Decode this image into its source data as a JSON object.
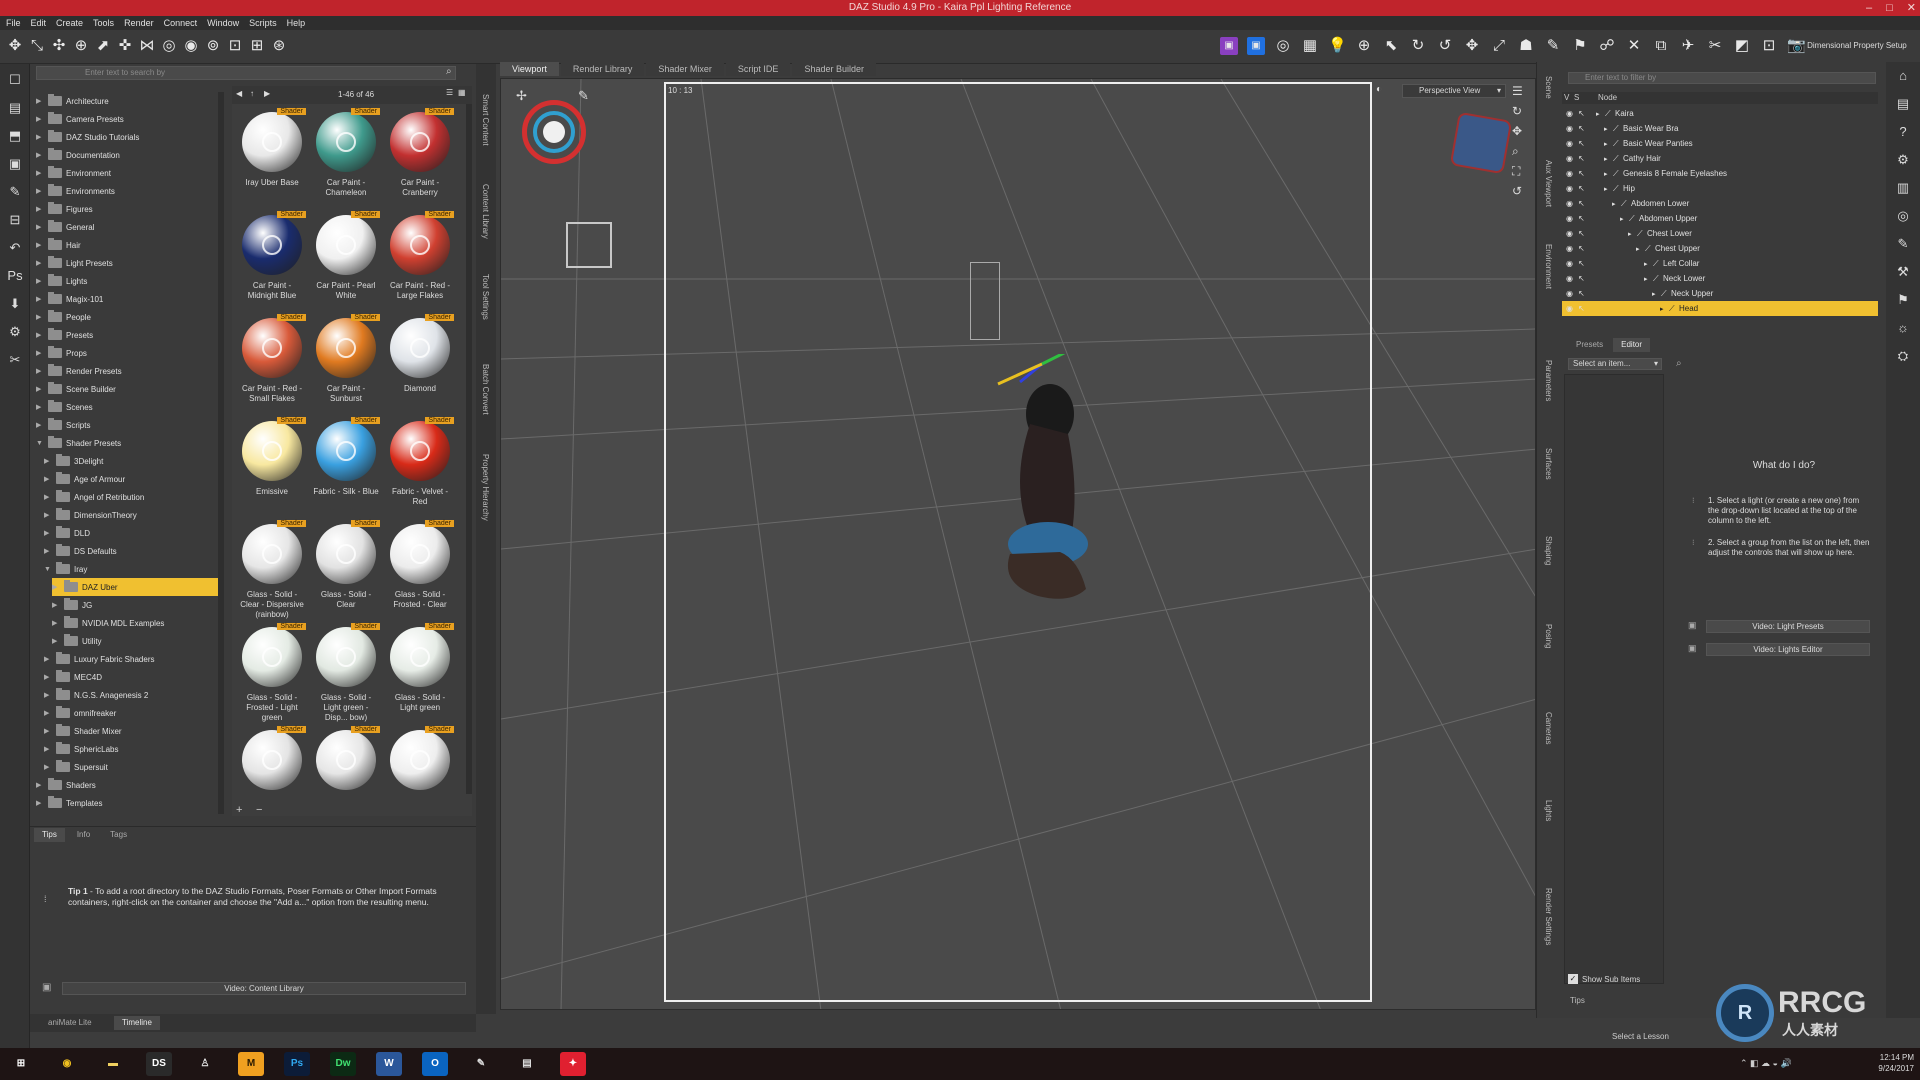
{
  "app": {
    "title": "DAZ Studio 4.9 Pro - Kaira Ppl Lighting Reference"
  },
  "menu": [
    "File",
    "Edit",
    "Create",
    "Tools",
    "Render",
    "Connect",
    "Window",
    "Scripts",
    "Help"
  ],
  "toolbar_right_label": "Multi Dimensional Property Setup",
  "content": {
    "search_placeholder": "Enter text to search by",
    "page_info": "1-46 of 46",
    "tree": [
      {
        "label": "Architecture",
        "depth": 1
      },
      {
        "label": "Camera Presets",
        "depth": 1
      },
      {
        "label": "DAZ Studio Tutorials",
        "depth": 1
      },
      {
        "label": "Documentation",
        "depth": 1
      },
      {
        "label": "Environment",
        "depth": 1
      },
      {
        "label": "Environments",
        "depth": 1
      },
      {
        "label": "Figures",
        "depth": 1
      },
      {
        "label": "General",
        "depth": 1
      },
      {
        "label": "Hair",
        "depth": 1
      },
      {
        "label": "Light Presets",
        "depth": 1
      },
      {
        "label": "Lights",
        "depth": 1
      },
      {
        "label": "Magix-101",
        "depth": 1
      },
      {
        "label": "People",
        "depth": 1
      },
      {
        "label": "Presets",
        "depth": 1
      },
      {
        "label": "Props",
        "depth": 1
      },
      {
        "label": "Render Presets",
        "depth": 1
      },
      {
        "label": "Scene Builder",
        "depth": 1
      },
      {
        "label": "Scenes",
        "depth": 1
      },
      {
        "label": "Scripts",
        "depth": 1
      },
      {
        "label": "Shader Presets",
        "depth": 1
      },
      {
        "label": "3Delight",
        "depth": 2
      },
      {
        "label": "Age of Armour",
        "depth": 2
      },
      {
        "label": "Angel of Retribution",
        "depth": 2
      },
      {
        "label": "DimensionTheory",
        "depth": 2
      },
      {
        "label": "DLD",
        "depth": 2
      },
      {
        "label": "DS Defaults",
        "depth": 2
      },
      {
        "label": "Iray",
        "depth": 2
      },
      {
        "label": "DAZ Uber",
        "depth": 3,
        "selected": true
      },
      {
        "label": "JG",
        "depth": 3
      },
      {
        "label": "NVIDIA MDL Examples",
        "depth": 3
      },
      {
        "label": "Utility",
        "depth": 3
      },
      {
        "label": "Luxury Fabric Shaders",
        "depth": 2
      },
      {
        "label": "MEC4D",
        "depth": 2
      },
      {
        "label": "N.G.S. Anagenesis 2",
        "depth": 2
      },
      {
        "label": "omnifreaker",
        "depth": 2
      },
      {
        "label": "Shader Mixer",
        "depth": 2
      },
      {
        "label": "SphericLabs",
        "depth": 2
      },
      {
        "label": "Supersuit",
        "depth": 2
      },
      {
        "label": "Shaders",
        "depth": 1
      },
      {
        "label": "Templates",
        "depth": 1
      }
    ],
    "badge": "Shader",
    "tiles": [
      {
        "label": "Iray Uber Base",
        "color": "#e8e8e8"
      },
      {
        "label": "Car Paint - Chameleon",
        "color": "#3f9a8c"
      },
      {
        "label": "Car Paint - Cranberry",
        "color": "#c23030"
      },
      {
        "label": "Car Paint - Midnight Blue",
        "color": "#1a2c6e"
      },
      {
        "label": "Car Paint - Pearl White",
        "color": "#f0f0f0"
      },
      {
        "label": "Car Paint - Red - Large Flakes",
        "color": "#d04030"
      },
      {
        "label": "Car Paint - Red - Small Flakes",
        "color": "#d85a3a"
      },
      {
        "label": "Car Paint - Sunburst",
        "color": "#e07a20"
      },
      {
        "label": "Diamond",
        "color": "#dfe3e8"
      },
      {
        "label": "Emissive",
        "color": "#f8e8a0"
      },
      {
        "label": "Fabric - Silk - Blue",
        "color": "#3aa0e0"
      },
      {
        "label": "Fabric - Velvet - Red",
        "color": "#d82a18"
      },
      {
        "label": "Glass - Solid - Clear - Dispersive (rainbow)",
        "color": "#e6e6e6"
      },
      {
        "label": "Glass - Solid - Clear",
        "color": "#e2e2e2"
      },
      {
        "label": "Glass - Solid - Frosted - Clear",
        "color": "#ececec"
      },
      {
        "label": "Glass - Solid - Frosted - Light green",
        "color": "#e4ebe4"
      },
      {
        "label": "Glass - Solid - Light green - Disp... bow)",
        "color": "#e2e9e2"
      },
      {
        "label": "Glass - Solid - Light green",
        "color": "#e6ece6"
      },
      {
        "label": "",
        "color": "#e4e4e4"
      },
      {
        "label": "",
        "color": "#e6e6e6"
      },
      {
        "label": "",
        "color": "#eeeeee"
      }
    ],
    "tips_tabs": [
      "Tips",
      "Info",
      "Tags"
    ],
    "tip_prefix": "Tip 1",
    "tip_text": " - To add a root directory to the DAZ Studio Formats, Poser Formats or Other Import Formats containers, right-click on the container and choose the \"Add a...\" option from the resulting menu.",
    "video_link": "Video: Content Library",
    "bottom_tabs": [
      "aniMate Lite",
      "Timeline"
    ],
    "side_tabs": [
      "Smart Content",
      "Content Library",
      "Tool Settings",
      "Batch Convert",
      "Property Hierarchy"
    ]
  },
  "viewport": {
    "tabs": [
      "Viewport",
      "Render Library",
      "Shader Mixer",
      "Script IDE",
      "Shader Builder"
    ],
    "aspect": "10 : 13",
    "view_label": "Perspective View"
  },
  "scene": {
    "filter_placeholder": "Enter text to filter by",
    "column": "Node",
    "nodes": [
      {
        "label": "Kaira",
        "depth": 0
      },
      {
        "label": "Basic Wear Bra",
        "depth": 1
      },
      {
        "label": "Basic Wear Panties",
        "depth": 1
      },
      {
        "label": "Cathy Hair",
        "depth": 1
      },
      {
        "label": "Genesis 8 Female Eyelashes",
        "depth": 1
      },
      {
        "label": "Hip",
        "depth": 1
      },
      {
        "label": "Abdomen Lower",
        "depth": 2
      },
      {
        "label": "Abdomen Upper",
        "depth": 3
      },
      {
        "label": "Chest Lower",
        "depth": 4
      },
      {
        "label": "Chest Upper",
        "depth": 5
      },
      {
        "label": "Left Collar",
        "depth": 6
      },
      {
        "label": "Neck Lower",
        "depth": 6
      },
      {
        "label": "Neck Upper",
        "depth": 7
      },
      {
        "label": "Head",
        "depth": 8,
        "selected": true
      }
    ],
    "side_tabs": [
      "Scene",
      "Aux Viewport",
      "Environment"
    ]
  },
  "lights_pane": {
    "tabs": [
      "Presets",
      "Editor"
    ],
    "select_label": "Select an item...",
    "heading": "What do I do?",
    "step1": "1. Select a light (or create a new one) from the drop-down list located at the top of the column to the left.",
    "step2": "2. Select a group from the list on the left, then adjust the controls that will show up here.",
    "btn1": "Video: Light Presets",
    "btn2": "Video: Lights Editor",
    "show_sub": "Show Sub Items",
    "tips": "Tips",
    "lesson": "Select a Lesson",
    "side_tabs": [
      "Parameters",
      "Surfaces",
      "Shaping",
      "Posing",
      "Cameras",
      "Lights",
      "Render Settings"
    ]
  },
  "taskbar": {
    "time": "12:14 PM",
    "date": "9/24/2017",
    "apps": [
      {
        "name": "start",
        "glyph": "⊞",
        "color": "#ffffff",
        "bg": "transparent"
      },
      {
        "name": "chrome",
        "glyph": "◉",
        "color": "#f0c020",
        "bg": "transparent"
      },
      {
        "name": "explorer",
        "glyph": "▬",
        "color": "#f0d060",
        "bg": "transparent"
      },
      {
        "name": "daz",
        "glyph": "DS",
        "color": "#ffffff",
        "bg": "#2a2a2a"
      },
      {
        "name": "app-figure",
        "glyph": "♙",
        "color": "#dddddd",
        "bg": "transparent"
      },
      {
        "name": "app-m",
        "glyph": "M",
        "color": "#2a1a00",
        "bg": "#f0a020"
      },
      {
        "name": "photoshop",
        "glyph": "Ps",
        "color": "#30a8f0",
        "bg": "#0c1c38"
      },
      {
        "name": "dreamweaver",
        "glyph": "Dw",
        "color": "#40e070",
        "bg": "#0c2a14"
      },
      {
        "name": "word",
        "glyph": "W",
        "color": "#ffffff",
        "bg": "#2b579a"
      },
      {
        "name": "outlook",
        "glyph": "O",
        "color": "#ffffff",
        "bg": "#0a64c0"
      },
      {
        "name": "app-pen",
        "glyph": "✎",
        "color": "#dddddd",
        "bg": "transparent"
      },
      {
        "name": "notepad",
        "glyph": "▤",
        "color": "#dddddd",
        "bg": "transparent"
      },
      {
        "name": "app-red",
        "glyph": "✦",
        "color": "#ffffff",
        "bg": "#e02030"
      }
    ]
  },
  "watermark": {
    "text": "RRCG",
    "subtext": "人人素材"
  },
  "colors": {
    "titlebar": "#c0242c",
    "selection": "#f0c030",
    "badge": "#e8a020"
  }
}
